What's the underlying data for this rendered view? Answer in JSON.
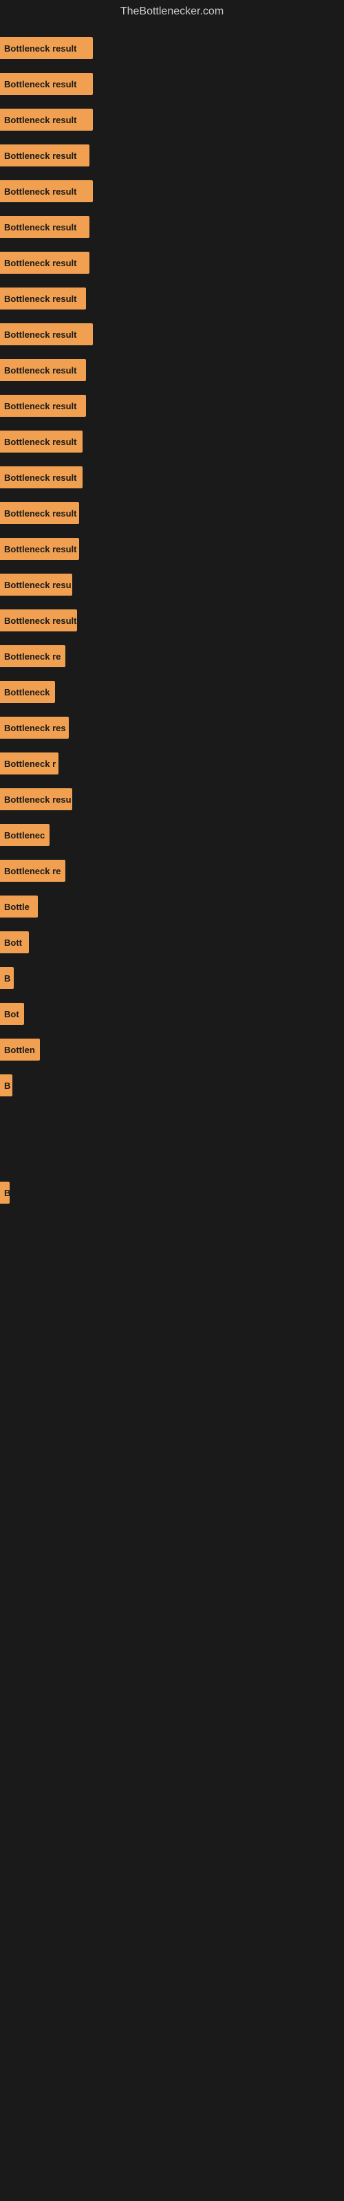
{
  "site": {
    "title": "TheBottlenecker.com"
  },
  "bars": [
    {
      "id": 1,
      "label": "Bottleneck result",
      "width": 135
    },
    {
      "id": 2,
      "label": "Bottleneck result",
      "width": 135
    },
    {
      "id": 3,
      "label": "Bottleneck result",
      "width": 135
    },
    {
      "id": 4,
      "label": "Bottleneck result",
      "width": 130
    },
    {
      "id": 5,
      "label": "Bottleneck result",
      "width": 135
    },
    {
      "id": 6,
      "label": "Bottleneck result",
      "width": 130
    },
    {
      "id": 7,
      "label": "Bottleneck result",
      "width": 130
    },
    {
      "id": 8,
      "label": "Bottleneck result",
      "width": 125
    },
    {
      "id": 9,
      "label": "Bottleneck result",
      "width": 135
    },
    {
      "id": 10,
      "label": "Bottleneck result",
      "width": 125
    },
    {
      "id": 11,
      "label": "Bottleneck result",
      "width": 125
    },
    {
      "id": 12,
      "label": "Bottleneck result",
      "width": 120
    },
    {
      "id": 13,
      "label": "Bottleneck result",
      "width": 120
    },
    {
      "id": 14,
      "label": "Bottleneck result",
      "width": 115
    },
    {
      "id": 15,
      "label": "Bottleneck result",
      "width": 115
    },
    {
      "id": 16,
      "label": "Bottleneck resu",
      "width": 105
    },
    {
      "id": 17,
      "label": "Bottleneck result",
      "width": 112
    },
    {
      "id": 18,
      "label": "Bottleneck re",
      "width": 95
    },
    {
      "id": 19,
      "label": "Bottleneck",
      "width": 80
    },
    {
      "id": 20,
      "label": "Bottleneck res",
      "width": 100
    },
    {
      "id": 21,
      "label": "Bottleneck r",
      "width": 85
    },
    {
      "id": 22,
      "label": "Bottleneck resu",
      "width": 105
    },
    {
      "id": 23,
      "label": "Bottlenec",
      "width": 72
    },
    {
      "id": 24,
      "label": "Bottleneck re",
      "width": 95
    },
    {
      "id": 25,
      "label": "Bottle",
      "width": 55
    },
    {
      "id": 26,
      "label": "Bott",
      "width": 42
    },
    {
      "id": 27,
      "label": "B",
      "width": 20
    },
    {
      "id": 28,
      "label": "Bot",
      "width": 35
    },
    {
      "id": 29,
      "label": "Bottlen",
      "width": 58
    },
    {
      "id": 30,
      "label": "B",
      "width": 18
    },
    {
      "id": 31,
      "label": "",
      "width": 0
    },
    {
      "id": 32,
      "label": "",
      "width": 0
    },
    {
      "id": 33,
      "label": "B",
      "width": 14
    },
    {
      "id": 34,
      "label": "",
      "width": 0
    },
    {
      "id": 35,
      "label": "",
      "width": 0
    },
    {
      "id": 36,
      "label": "",
      "width": 0
    },
    {
      "id": 37,
      "label": "",
      "width": 0
    },
    {
      "id": 38,
      "label": "",
      "width": 0
    },
    {
      "id": 39,
      "label": "",
      "width": 0
    },
    {
      "id": 40,
      "label": "",
      "width": 0
    },
    {
      "id": 41,
      "label": "",
      "width": 0
    },
    {
      "id": 42,
      "label": "",
      "width": 0
    },
    {
      "id": 43,
      "label": "",
      "width": 0
    },
    {
      "id": 44,
      "label": "",
      "width": 0
    },
    {
      "id": 45,
      "label": "",
      "width": 0
    },
    {
      "id": 46,
      "label": "",
      "width": 0
    },
    {
      "id": 47,
      "label": "",
      "width": 0
    },
    {
      "id": 48,
      "label": "",
      "width": 0
    },
    {
      "id": 49,
      "label": "",
      "width": 0
    },
    {
      "id": 50,
      "label": "",
      "width": 0
    },
    {
      "id": 51,
      "label": "",
      "width": 0
    },
    {
      "id": 52,
      "label": "",
      "width": 0
    },
    {
      "id": 53,
      "label": "",
      "width": 0
    },
    {
      "id": 54,
      "label": "",
      "width": 0
    },
    {
      "id": 55,
      "label": "",
      "width": 0
    },
    {
      "id": 56,
      "label": "",
      "width": 0
    },
    {
      "id": 57,
      "label": "",
      "width": 0
    },
    {
      "id": 58,
      "label": "",
      "width": 0
    },
    {
      "id": 59,
      "label": "",
      "width": 0
    },
    {
      "id": 60,
      "label": "",
      "width": 0
    }
  ]
}
